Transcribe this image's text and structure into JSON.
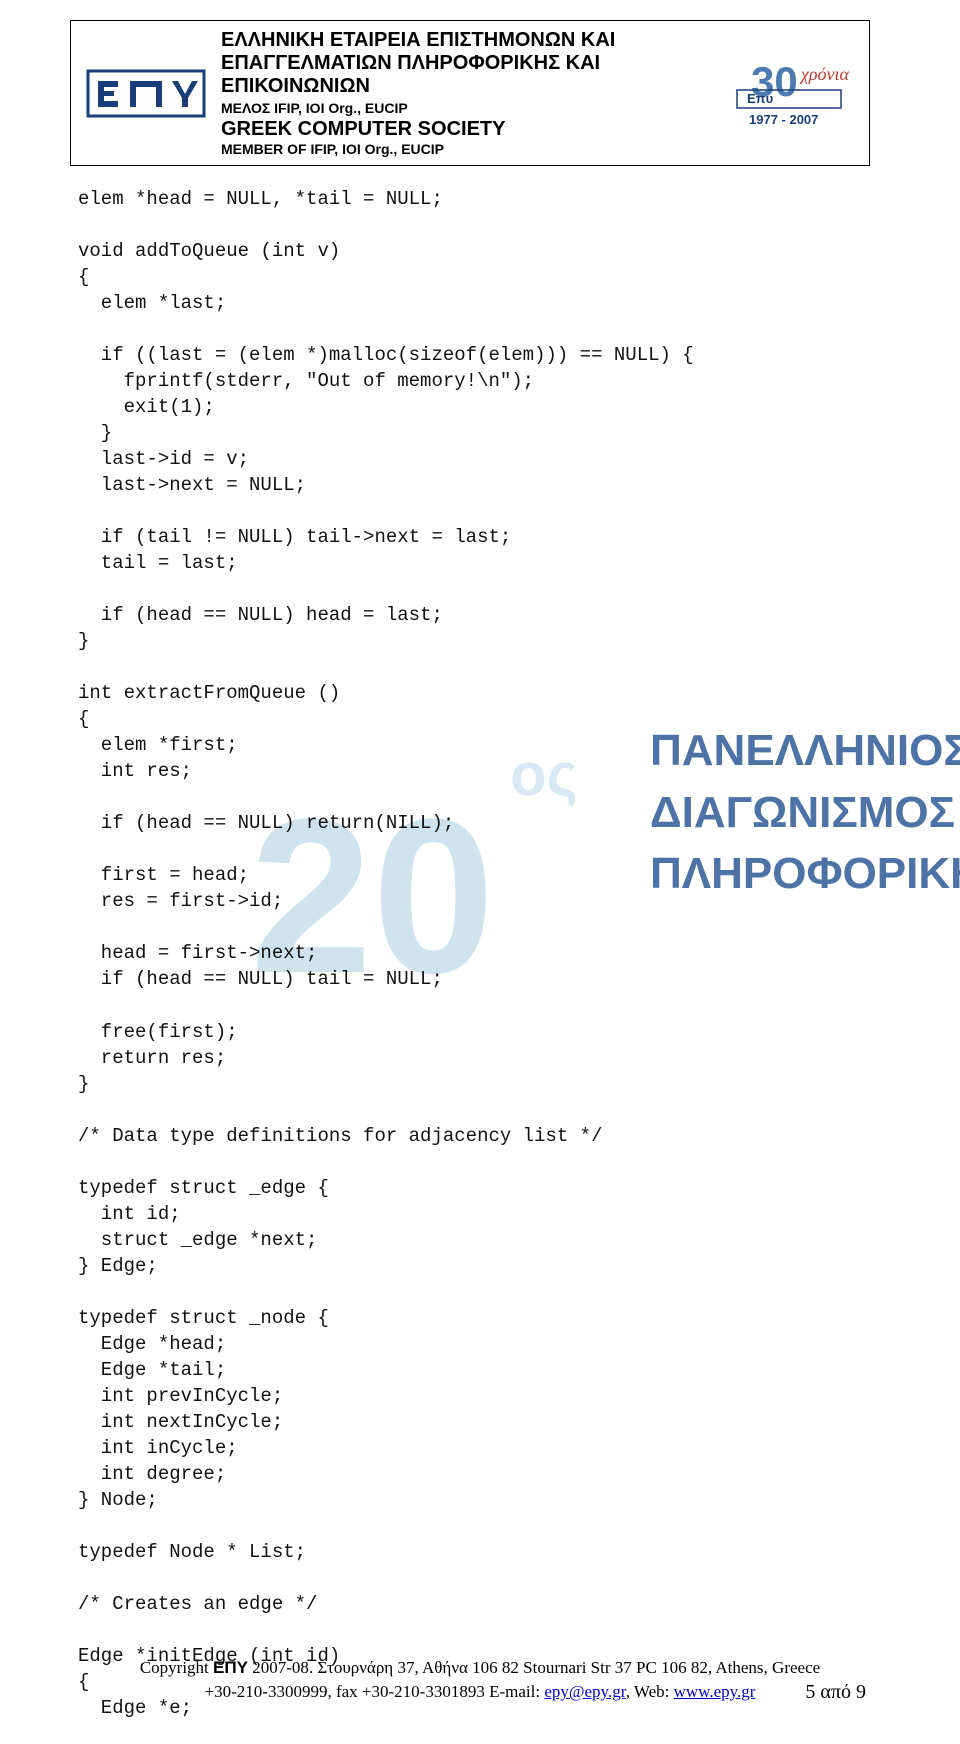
{
  "header": {
    "gr_line1": "ΕΛΛΗΝΙΚΗ ΕΤΑΙΡΕΙΑ ΕΠΙΣΤΗΜΟΝΩΝ ΚΑΙ",
    "gr_line2": "ΕΠΑΓΓΕΛΜΑΤΙΩΝ ΠΛΗΡΟΦΟΡΙΚΗΣ ΚΑΙ",
    "gr_line3": "ΕΠΙΚΟΙΝΩΝΙΩΝ",
    "gr_member": "ΜΕΛΟΣ IFIP, IOI Org., EUCIP",
    "en_title": "GREEK COMPUTER SOCIETY",
    "en_member": "MEMBER OF IFIP, IOI Org., EUCIP",
    "anniv_years": "1977 - 2007",
    "anniv_label": "χρόνια",
    "anniv_num": "30",
    "logo_text": "ΕΠΥ"
  },
  "watermark": {
    "big": "20",
    "os": "ος",
    "line1": "ΠΑΝΕΛΛΗΝΙΟΣ",
    "line2": "ΔΙΑΓΩΝΙΣΜΟΣ",
    "line3": "ΠΛΗΡΟΦΟΡΙΚΗΣ"
  },
  "code": "elem *head = NULL, *tail = NULL;\n\nvoid addToQueue (int v)\n{\n  elem *last;\n\n  if ((last = (elem *)malloc(sizeof(elem))) == NULL) {\n    fprintf(stderr, \"Out of memory!\\n\");\n    exit(1);\n  }\n  last->id = v;\n  last->next = NULL;\n\n  if (tail != NULL) tail->next = last;\n  tail = last;\n\n  if (head == NULL) head = last;\n}\n\nint extractFromQueue ()\n{\n  elem *first;\n  int res;\n\n  if (head == NULL) return(NILL);\n\n  first = head;\n  res = first->id;\n\n  head = first->next;\n  if (head == NULL) tail = NULL;\n\n  free(first);\n  return res;\n}\n\n/* Data type definitions for adjacency list */\n\ntypedef struct _edge {\n  int id;\n  struct _edge *next;\n} Edge;\n\ntypedef struct _node {\n  Edge *head;\n  Edge *tail;\n  int prevInCycle;\n  int nextInCycle;\n  int inCycle;\n  int degree;\n} Node;\n\ntypedef Node * List;\n\n/* Creates an edge */\n\nEdge *initEdge (int id)\n{\n  Edge *e;",
  "footer": {
    "copyright_prefix": "Copyright ",
    "epy": "ΕΠΥ",
    "copyright_suffix": " 2007-08. Στουρνάρη 37, Αθήνα 106 82 Stournari Str 37 PC 106 82, Athens, Greece",
    "contact_prefix": "+30-210-3300999, fax +30-210-3301893 E-mail: ",
    "email": "epy@epy.gr",
    "web_label": ", Web: ",
    "web": "www.epy.gr",
    "page": "5 από 9"
  }
}
